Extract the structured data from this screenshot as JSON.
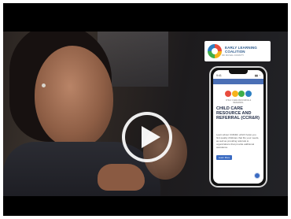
{
  "video": {
    "play_label": "Play video"
  },
  "logo": {
    "name": "EARLY LEARNING COALITION",
    "sub": "OF DUVAL COUNTY"
  },
  "phone": {
    "status_time": "9:41",
    "status_icons": "▮▮ ◔",
    "ccr_tagline": "CHILD CARE RESOURCE & REFERRAL",
    "title": "CHILD CARE RESOURCE AND REFERRAL (CCR&R)",
    "body": "Learn about CCR&R, which helps you find quality childcare that fits your needs, as well as providing referrals to organizations that provide additional assistance.",
    "button_label": "Learn More",
    "fab_icon": "accessibility-icon"
  },
  "colors": {
    "brand_blue": "#3a6bc2",
    "logo_red": "#e84c3d",
    "logo_yellow": "#f6b21a",
    "logo_green": "#3fae49",
    "logo_blue": "#2d7fc1"
  }
}
